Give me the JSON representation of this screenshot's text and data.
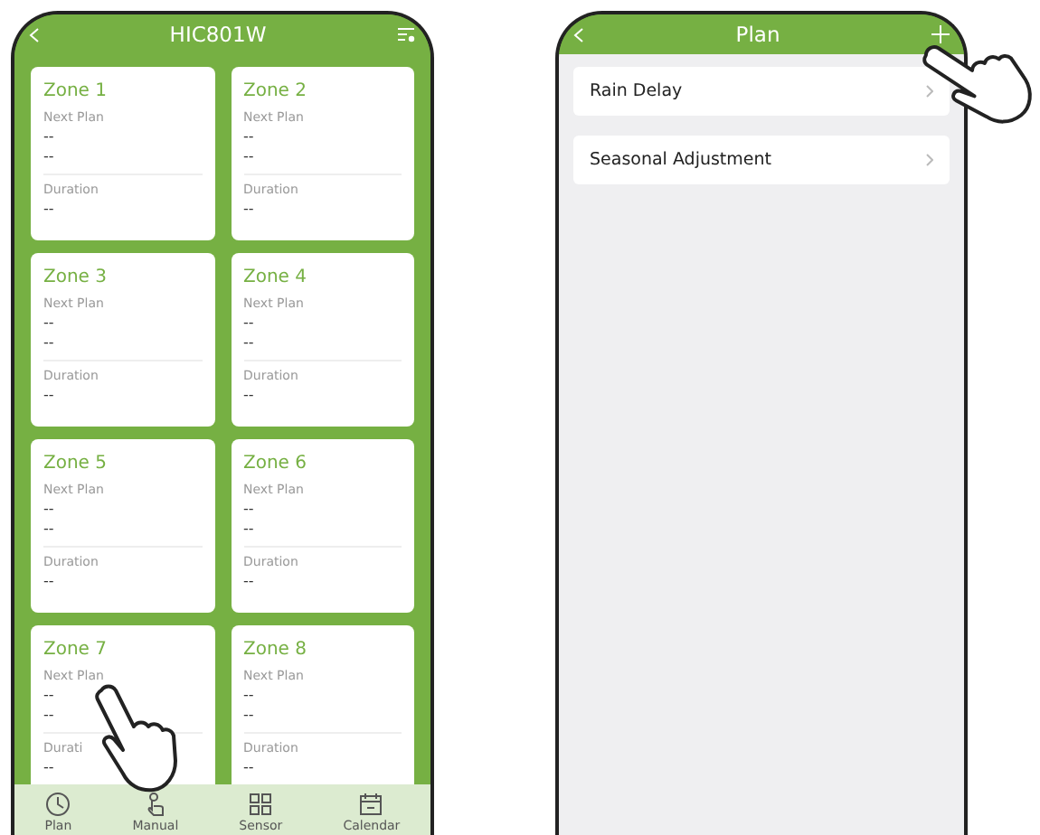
{
  "left_phone": {
    "title": "HIC801W",
    "zones": [
      {
        "name": "Zone 1",
        "next_plan_label": "Next Plan",
        "next_plan_lines": [
          "--",
          "--"
        ],
        "duration_label": "Duration",
        "duration": "--"
      },
      {
        "name": "Zone 2",
        "next_plan_label": "Next Plan",
        "next_plan_lines": [
          "--",
          "--"
        ],
        "duration_label": "Duration",
        "duration": "--"
      },
      {
        "name": "Zone 3",
        "next_plan_label": "Next Plan",
        "next_plan_lines": [
          "--",
          "--"
        ],
        "duration_label": "Duration",
        "duration": "--"
      },
      {
        "name": "Zone 4",
        "next_plan_label": "Next Plan",
        "next_plan_lines": [
          "--",
          "--"
        ],
        "duration_label": "Duration",
        "duration": "--"
      },
      {
        "name": "Zone 5",
        "next_plan_label": "Next Plan",
        "next_plan_lines": [
          "--",
          "--"
        ],
        "duration_label": "Duration",
        "duration": "--"
      },
      {
        "name": "Zone 6",
        "next_plan_label": "Next Plan",
        "next_plan_lines": [
          "--",
          "--"
        ],
        "duration_label": "Duration",
        "duration": "--"
      },
      {
        "name": "Zone 7",
        "next_plan_label": "Next Plan",
        "next_plan_lines": [
          "--",
          "--"
        ],
        "duration_label": "Durati",
        "duration": "--"
      },
      {
        "name": "Zone 8",
        "next_plan_label": "Next Plan",
        "next_plan_lines": [
          "--",
          "--"
        ],
        "duration_label": "Duration",
        "duration": "--"
      }
    ],
    "nav": [
      {
        "kind": "clock",
        "label": "Plan"
      },
      {
        "kind": "hand",
        "label": "Manual"
      },
      {
        "kind": "grid",
        "label": "Sensor"
      },
      {
        "kind": "calendar",
        "label": "Calendar"
      }
    ]
  },
  "right_phone": {
    "title": "Plan",
    "items": [
      {
        "label": "Rain Delay"
      },
      {
        "label": "Seasonal Adjustment"
      }
    ]
  }
}
